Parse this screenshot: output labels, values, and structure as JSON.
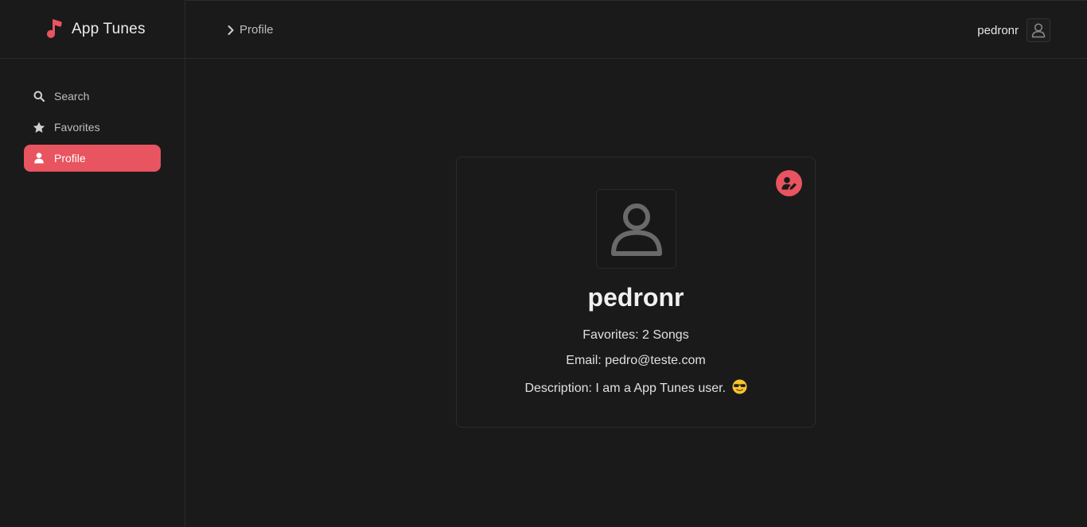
{
  "brand": {
    "name": "App Tunes",
    "icon": "music-note-icon",
    "accent": "#e8545f"
  },
  "sidebar": {
    "items": [
      {
        "label": "Search",
        "icon": "search-icon",
        "active": false
      },
      {
        "label": "Favorites",
        "icon": "star-icon",
        "active": false
      },
      {
        "label": "Profile",
        "icon": "user-icon",
        "active": true
      }
    ]
  },
  "header": {
    "breadcrumb": "Profile",
    "username": "pedronr"
  },
  "profile": {
    "name": "pedronr",
    "favorites_label": "Favorites:",
    "favorites_value": "2 Songs",
    "email_label": "Email:",
    "email_value": "pedro@teste.com",
    "description_label": "Description:",
    "description_value": "I am a App Tunes user.",
    "description_emoji": "sunglasses-emoji"
  },
  "colors": {
    "background": "#1a1a1a",
    "accent": "#e8545f",
    "border": "#2b2b2b"
  }
}
